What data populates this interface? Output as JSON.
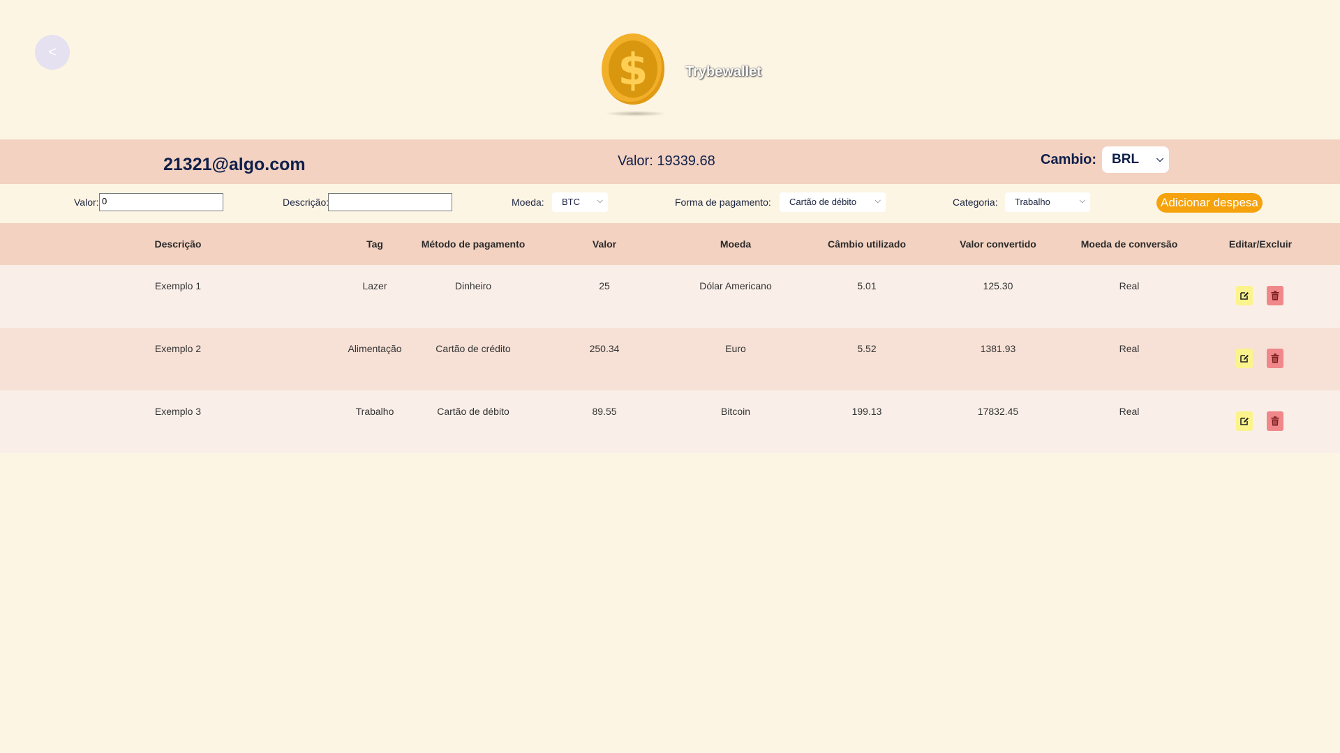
{
  "nav": {
    "back_label": "<"
  },
  "header": {
    "brand": "Trybewallet",
    "coin_symbol": "$"
  },
  "summary": {
    "email": "21321@algo.com",
    "total": "Valor: 19339.68",
    "cambio_label": "Cambio:",
    "cambio_value": "BRL"
  },
  "form": {
    "valor_label": "Valor:",
    "valor_value": "0",
    "descricao_label": "Descrição:",
    "descricao_value": "",
    "moeda_label": "Moeda:",
    "moeda_value": "BTC",
    "pagamento_label": "Forma de pagamento:",
    "pagamento_value": "Cartão de débito",
    "categoria_label": "Categoria:",
    "categoria_value": "Trabalho",
    "add_button": "Adicionar despesa"
  },
  "table": {
    "headers": [
      "Descrição",
      "Tag",
      "Método de pagamento",
      "Valor",
      "Moeda",
      "Câmbio utilizado",
      "Valor convertido",
      "Moeda de conversão",
      "Editar/Excluir"
    ],
    "rows": [
      [
        "Exemplo 1",
        "Lazer",
        "Dinheiro",
        "25",
        "Dólar Americano",
        "5.01",
        "125.30",
        "Real"
      ],
      [
        "Exemplo 2",
        "Alimentação",
        "Cartão de crédito",
        "250.34",
        "Euro",
        "5.52",
        "1381.93",
        "Real"
      ],
      [
        "Exemplo 3",
        "Trabalho",
        "Cartão de débito",
        "89.55",
        "Bitcoin",
        "199.13",
        "17832.45",
        "Real"
      ]
    ]
  },
  "icons": {
    "edit": "edit-icon",
    "delete": "trash-icon",
    "select_arrow": "chevron-down-icon"
  },
  "colors": {
    "background": "#fdf5e4",
    "bar": "#f3d2c1",
    "accent": "#f5a20c",
    "edit_button": "#fbf38c",
    "delete_button": "#f0878a",
    "text": "#0f1f4a"
  }
}
